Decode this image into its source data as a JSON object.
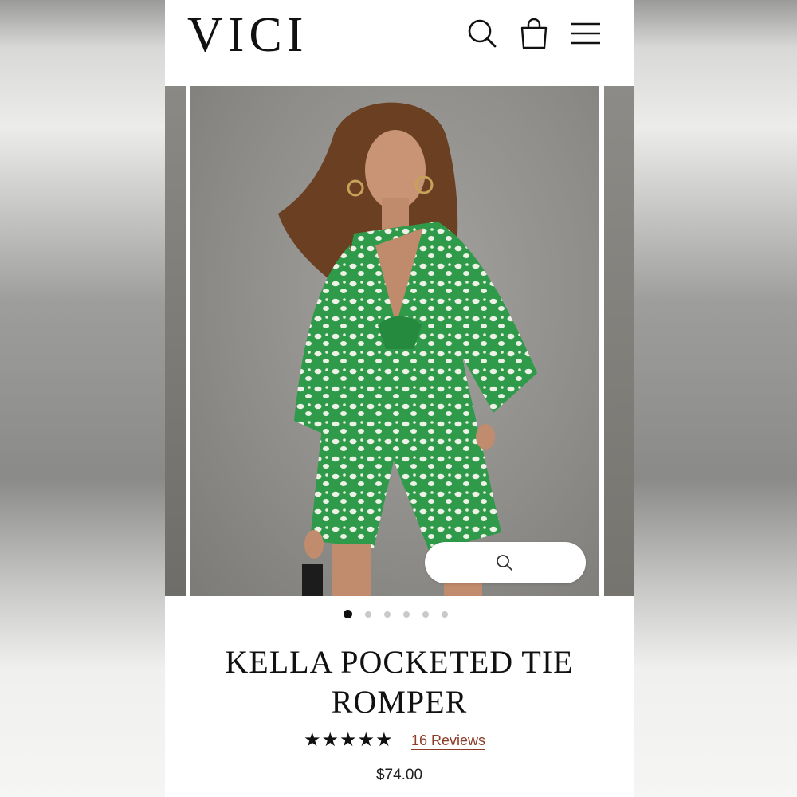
{
  "header": {
    "logo": "VICI",
    "icons": [
      "search-icon",
      "shopping-bag-icon",
      "menu-icon"
    ]
  },
  "gallery": {
    "slide_count": 6,
    "active_index": 0,
    "zoom_icon": "search-icon",
    "colors": {
      "dress_green": "#2f9a4a",
      "pattern": "#eef2e6",
      "backdrop": "#8f8e8a"
    }
  },
  "product": {
    "title": "KELLA POCKETED TIE ROMPER",
    "rating": 5,
    "stars": "★★★★★",
    "reviews_label": "16 Reviews",
    "price": "$74.00"
  },
  "colors": {
    "reviews_link": "#8a3c25",
    "text": "#111111",
    "background": "#ffffff"
  }
}
